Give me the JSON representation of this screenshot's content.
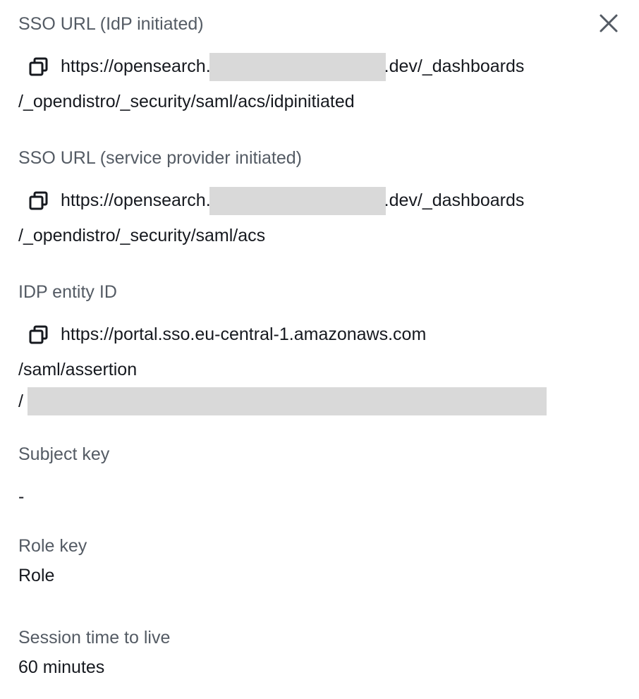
{
  "panel": {
    "close_icon": "close-icon",
    "copy_icon": "copy-icon"
  },
  "sso_idp": {
    "label": "SSO URL (IdP initiated)",
    "line1_prefix": "https://opensearch.",
    "line1_suffix": ".dev/_dashboards",
    "line2": "/_opendistro/_security/saml/acs/idpinitiated"
  },
  "sso_sp": {
    "label": "SSO URL (service provider initiated)",
    "line1_prefix": "https://opensearch.",
    "line1_suffix": ".dev/_dashboards",
    "line2": "/_opendistro/_security/saml/acs"
  },
  "idp_entity": {
    "label": "IDP entity ID",
    "line1": "https://portal.sso.eu-central-1.amazonaws.com",
    "line2": "/saml/assertion",
    "line3_prefix": "/"
  },
  "subject_key": {
    "label": "Subject key",
    "value": "-"
  },
  "role_key": {
    "label": "Role key",
    "value": "Role"
  },
  "session_ttl": {
    "label": "Session time to live",
    "value": "60 minutes"
  },
  "colors": {
    "label": "#545b64",
    "text": "#16191f",
    "redaction": "#d9d9d9"
  }
}
